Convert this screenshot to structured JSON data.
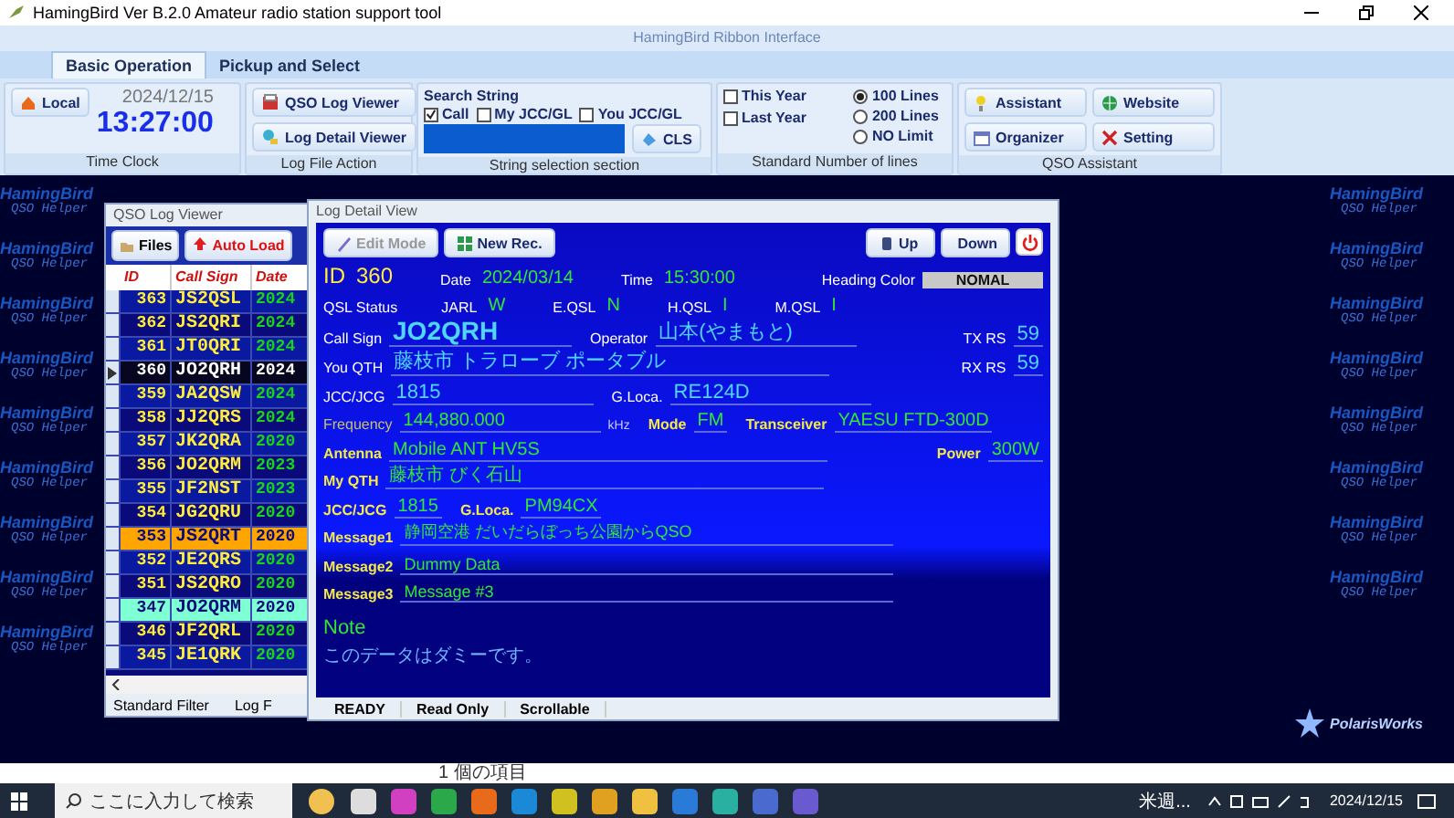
{
  "window": {
    "title": "HamingBird Ver B.2.0  Amateur radio station support tool",
    "ribbon_title": "HamingBird Ribbon Interface"
  },
  "tabs": [
    {
      "label": "Basic Operation",
      "selected": true
    },
    {
      "label": "Pickup and Select",
      "selected": false
    }
  ],
  "ribbon": {
    "time_clock": {
      "button": "Local",
      "date": "2024/12/15",
      "time": "13:27:00",
      "caption": "Time Clock"
    },
    "log_file": {
      "buttons": [
        "QSO Log Viewer",
        "Log Detail Viewer"
      ],
      "caption": "Log File Action"
    },
    "search": {
      "title": "Search String",
      "options": [
        {
          "label": "Call",
          "checked": true
        },
        {
          "label": "My JCC/GL",
          "checked": false
        },
        {
          "label": "You JCC/GL",
          "checked": false
        }
      ],
      "button": "CLS",
      "caption": "String selection section"
    },
    "lines": {
      "checks": [
        {
          "label": "This Year",
          "checked": false
        },
        {
          "label": "Last Year",
          "checked": false
        }
      ],
      "radios": [
        {
          "label": "100 Lines",
          "selected": true
        },
        {
          "label": "200 Lines",
          "selected": false
        },
        {
          "label": "NO Limit",
          "selected": false
        }
      ],
      "caption": "Standard Number of lines"
    },
    "assistant": {
      "buttons": [
        "Assistant",
        "Website",
        "Organizer",
        "Setting"
      ],
      "caption": "QSO Assistant"
    }
  },
  "wallpaper": {
    "left": [
      {
        "title": "HamingBird",
        "subtitle": "QSO Helper"
      },
      {
        "title": "HamingBird",
        "subtitle": "QSO Helper"
      },
      {
        "title": "HamingBird",
        "subtitle": "QSO Helper"
      },
      {
        "title": "HamingBird",
        "subtitle": "QSO Helper"
      },
      {
        "title": "HamingBird",
        "subtitle": "QSO Helper"
      },
      {
        "title": "HamingBird",
        "subtitle": "QSO Helper"
      },
      {
        "title": "HamingBird",
        "subtitle": "QSO Helper"
      },
      {
        "title": "HamingBird",
        "subtitle": "QSO Helper"
      },
      {
        "title": "HamingBird",
        "subtitle": "QSO Helper"
      }
    ],
    "right": [
      {
        "title": "HamingBird",
        "subtitle": "QSO Helper"
      },
      {
        "title": "HamingBird",
        "subtitle": "QSO Helper"
      },
      {
        "title": "HamingBird",
        "subtitle": "QSO Helper"
      },
      {
        "title": "HamingBird",
        "subtitle": "QSO Helper"
      },
      {
        "title": "HamingBird",
        "subtitle": "QSO Helper"
      },
      {
        "title": "HamingBird",
        "subtitle": "QSO Helper"
      },
      {
        "title": "HamingBird",
        "subtitle": "QSO Helper"
      },
      {
        "title": "HamingBird",
        "subtitle": "QSO Helper"
      }
    ],
    "logo": "PolarisWorks"
  },
  "log_viewer": {
    "title": "QSO Log Viewer",
    "buttons": [
      "Files",
      "Auto Load"
    ],
    "columns": [
      "ID",
      "Call Sign",
      "Date"
    ],
    "rows": [
      {
        "id": "363",
        "call": "JS2QSL",
        "date": "2024",
        "selected": false,
        "color": "#0a1aa0"
      },
      {
        "id": "362",
        "call": "JS2QRI",
        "date": "2024",
        "selected": false,
        "color": "#0a0a7a"
      },
      {
        "id": "361",
        "call": "JT0QRI",
        "date": "2024",
        "selected": false,
        "color": "#0a1aa0"
      },
      {
        "id": "360",
        "call": "JO2QRH",
        "date": "2024",
        "selected": true
      },
      {
        "id": "359",
        "call": "JA2QSW",
        "date": "2024",
        "selected": false,
        "color": "#0a1aa0"
      },
      {
        "id": "358",
        "call": "JJ2QRS",
        "date": "2024",
        "selected": false,
        "color": "#0a0a7a"
      },
      {
        "id": "357",
        "call": "JK2QRA",
        "date": "2020",
        "selected": false,
        "color": "#0a1aa0"
      },
      {
        "id": "356",
        "call": "JO2QRM",
        "date": "2023",
        "selected": false,
        "color": "#0a0a7a"
      },
      {
        "id": "355",
        "call": "JF2NST",
        "date": "2023",
        "selected": false,
        "color": "#0a1aa0"
      },
      {
        "id": "354",
        "call": "JG2QRU",
        "date": "2020",
        "selected": false,
        "color": "#0a0a7a"
      },
      {
        "id": "353",
        "call": "JS2QRT",
        "date": "2020",
        "selected": false,
        "color": "#ffa500"
      },
      {
        "id": "352",
        "call": "JE2QRS",
        "date": "2020",
        "selected": false,
        "color": "#0a1aa0"
      },
      {
        "id": "351",
        "call": "JS2QRO",
        "date": "2020",
        "selected": false,
        "color": "#0a0a7a"
      },
      {
        "id": "347",
        "call": "JO2QRM",
        "date": "2020",
        "selected": false,
        "color": "#7fffd4"
      },
      {
        "id": "346",
        "call": "JF2QRL",
        "date": "2020",
        "selected": false,
        "color": "#0a0a7a"
      },
      {
        "id": "345",
        "call": "JE1QRK",
        "date": "2020",
        "selected": false,
        "color": "#0a1aa0"
      }
    ],
    "status": [
      "Standard Filter",
      "Log F"
    ]
  },
  "detail": {
    "title": "Log Detail View",
    "toolbar": [
      {
        "label": "Edit Mode",
        "disabled": true
      },
      {
        "label": "New Rec.",
        "disabled": false
      }
    ],
    "nav": [
      "Up",
      "Down"
    ],
    "rows": [
      {
        "fields": [
          {
            "kind": "id",
            "label": "ID",
            "value": "360"
          },
          {
            "kind": "green",
            "label": "Date",
            "value": "2024/03/14"
          },
          {
            "kind": "green",
            "label": "Time",
            "value": "15:30:00"
          },
          {
            "kind": "badge",
            "label": "Heading Color",
            "value": "NOMAL"
          }
        ]
      },
      {
        "fields": [
          {
            "kind": "title",
            "label": "QSL Status"
          },
          {
            "kind": "flag",
            "label": "JARL",
            "value": "W"
          },
          {
            "kind": "flag",
            "label": "E.QSL",
            "value": "N"
          },
          {
            "kind": "flag",
            "label": "H.QSL",
            "value": "I"
          },
          {
            "kind": "flag",
            "label": "M.QSL",
            "value": "I"
          }
        ]
      },
      {
        "fields": [
          {
            "kind": "big",
            "label": "Call Sign",
            "value": "JO2QRH"
          },
          {
            "kind": "field",
            "label": "Operator",
            "value": "山本(やまもと)"
          },
          {
            "kind": "rs",
            "label": "TX RS",
            "value": "59"
          }
        ]
      },
      {
        "fields": [
          {
            "kind": "wide",
            "label": "You QTH",
            "value": "藤枝市 トラローブ ポータブル"
          },
          {
            "kind": "rs",
            "label": "RX RS",
            "value": "59"
          }
        ]
      },
      {
        "fields": [
          {
            "kind": "field",
            "label": "JCC/JCG",
            "value": "1815"
          },
          {
            "kind": "field",
            "label": "G.Loca.",
            "value": "RE124D"
          }
        ]
      },
      {
        "fields": [
          {
            "kind": "freq",
            "label": "Frequency",
            "value": "144,880.000",
            "unit": "kHz"
          },
          {
            "kind": "sub",
            "label": "Mode",
            "value": "FM"
          },
          {
            "kind": "sub",
            "label": "Transceiver",
            "value": "YAESU FTD-300D"
          }
        ]
      },
      {
        "fields": [
          {
            "kind": "subwide",
            "label": "Antenna",
            "value": "Mobile ANT HV5S"
          },
          {
            "kind": "sub",
            "label": "Power",
            "value": "300W"
          }
        ]
      },
      {
        "fields": [
          {
            "kind": "subwide",
            "label": "My QTH",
            "value": "藤枝市 びく石山"
          }
        ]
      },
      {
        "fields": [
          {
            "kind": "sub",
            "label": "JCC/JCG",
            "value": "1815"
          },
          {
            "kind": "sub",
            "label": "G.Loca.",
            "value": "PM94CX"
          }
        ]
      },
      {
        "fields": [
          {
            "kind": "msg",
            "label": "Message1",
            "value": "静岡空港 だいだらぼっち公園からQSO"
          }
        ]
      },
      {
        "fields": [
          {
            "kind": "msg",
            "label": "Message2",
            "value": "Dummy Data"
          }
        ]
      },
      {
        "fields": [
          {
            "kind": "msg",
            "label": "Message3",
            "value": "Message #3"
          }
        ]
      }
    ],
    "note_label": "Note",
    "note": "このデータはダミーです。",
    "status": [
      "READY",
      "Read Only",
      "Scrollable"
    ]
  },
  "hint": "1 個の項目",
  "taskbar": {
    "search": "ここに入力して検索",
    "weather": "米週...",
    "date": "2024/12/15"
  }
}
